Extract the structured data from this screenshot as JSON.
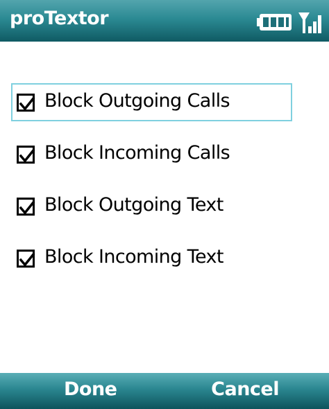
{
  "app": {
    "title": "proTextor"
  },
  "status": {
    "battery_icon": "battery-icon",
    "signal_icon": "signal-strength-icon"
  },
  "options": [
    {
      "label": "Block Outgoing Calls",
      "checked": true,
      "focused": true
    },
    {
      "label": "Block Incoming Calls",
      "checked": true,
      "focused": false
    },
    {
      "label": "Block Outgoing Text",
      "checked": true,
      "focused": false
    },
    {
      "label": "Block Incoming Text",
      "checked": true,
      "focused": false
    }
  ],
  "softkeys": {
    "left": "Done",
    "right": "Cancel"
  },
  "colors": {
    "bar_top": "#53a5ad",
    "bar_bottom": "#0f5a63",
    "focus_border": "#7fd0df"
  }
}
